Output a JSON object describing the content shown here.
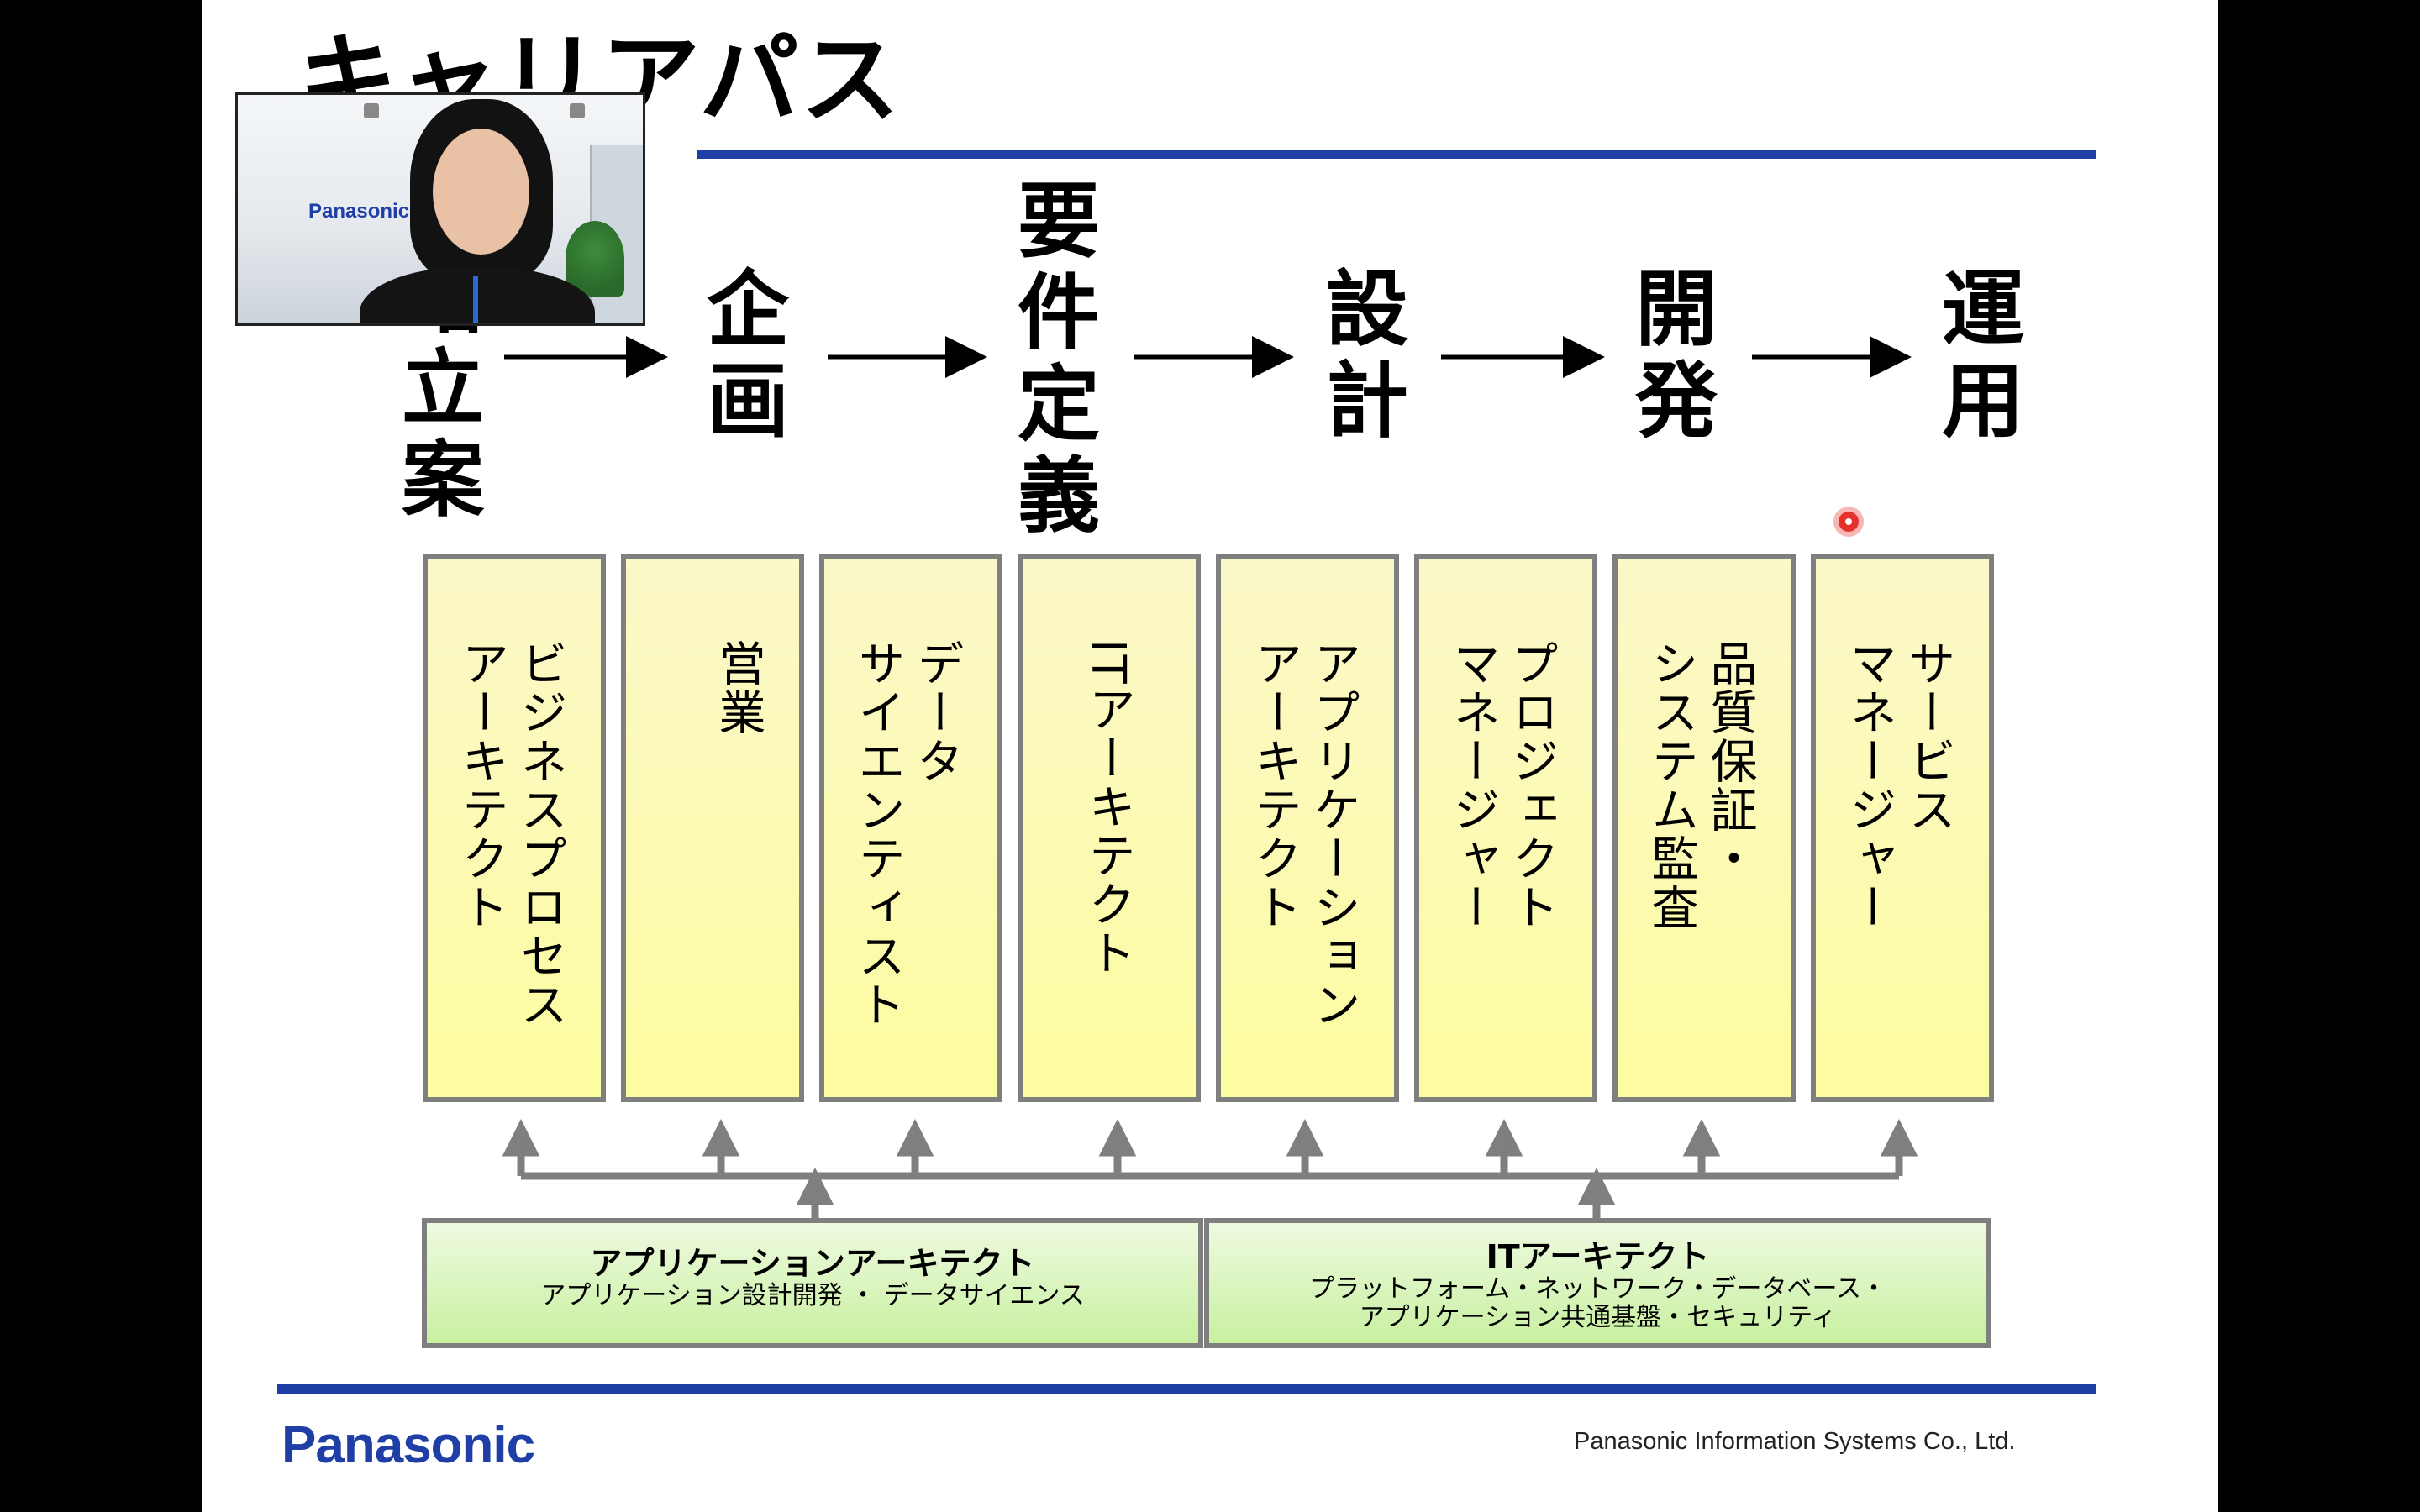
{
  "slide": {
    "title": "キャリアパス",
    "stages": [
      {
        "id": "strategy",
        "chars": [
          "略",
          "立",
          "案"
        ]
      },
      {
        "id": "planning",
        "chars": [
          "企",
          "画"
        ]
      },
      {
        "id": "requirements",
        "chars": [
          "要",
          "件",
          "定",
          "義"
        ]
      },
      {
        "id": "design",
        "chars": [
          "設",
          "計"
        ]
      },
      {
        "id": "development",
        "chars": [
          "開",
          "発"
        ]
      },
      {
        "id": "operation",
        "chars": [
          "運",
          "用"
        ]
      }
    ],
    "roles": [
      "ビジネスプロセスアーキテクト",
      "営業",
      "データサイエンティスト",
      "ITアーキテクト",
      "アプリケーションアーキテクト",
      "プロジェクトマネージャー",
      "品質保証・システム監査",
      "サービスマネージャー"
    ],
    "roles_display": [
      "ビジネスプロセス\nアーキテクト",
      "営業",
      "データ\nサイエンティスト",
      "ITアーキテクト",
      "アプリケーション\nアーキテクト",
      "プロジェクト\nマネージャー",
      "品質保証・\nシステム監査",
      "サービス\nマネージャー"
    ],
    "foundations": [
      {
        "title": "アプリケーションアーキテクト",
        "lines": [
          "アプリケーション設計開発 ・ データサイエンス"
        ]
      },
      {
        "title": "ITアーキテクト",
        "lines": [
          "プラットフォーム・ネットワーク・データベース・",
          "アプリケーション共通基盤・セキュリティ"
        ]
      }
    ],
    "footer": {
      "logo": "Panasonic",
      "company": "Panasonic Information Systems Co., Ltd."
    },
    "colors": {
      "rule": "#1f3fa6",
      "role_fill": "#fdfca0",
      "foundation_fill": "#c8f0a0",
      "box_border": "#7f7f7f"
    }
  },
  "video": {
    "backdrop_logo": "Panasonic"
  }
}
